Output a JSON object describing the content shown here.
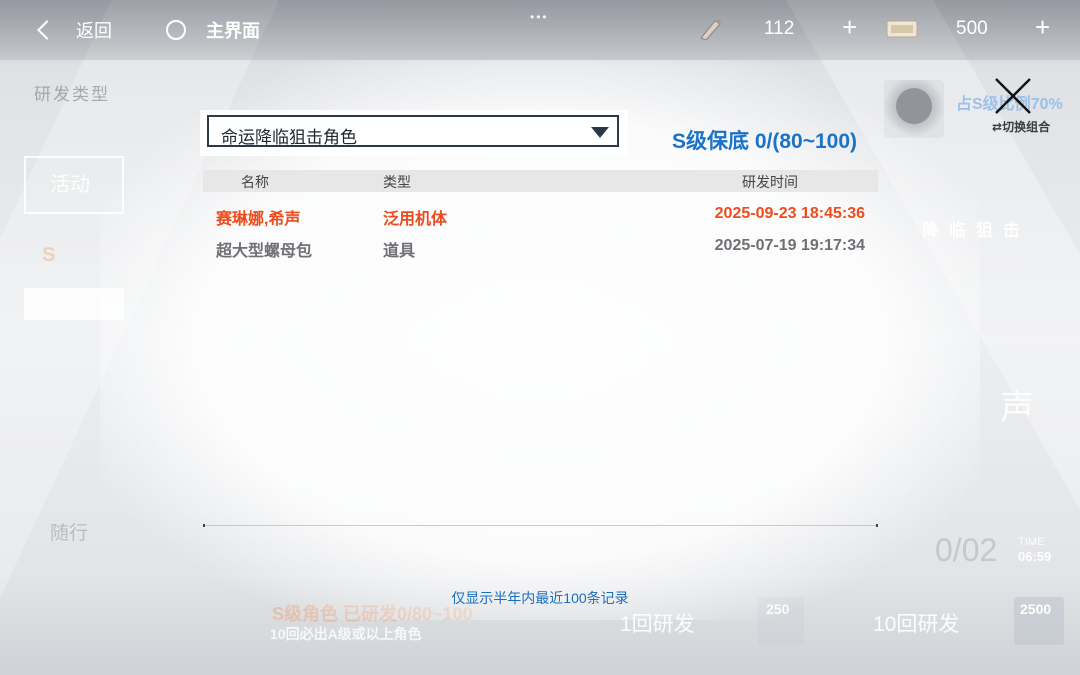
{
  "topbar": {
    "back_label": "返回",
    "home_label": "主界面",
    "resource_1": {
      "icon": "pen-icon",
      "value": "112"
    },
    "resource_2": {
      "icon": "ticket-icon",
      "value": "500"
    },
    "plus": "+"
  },
  "dialog": {
    "dropdown_selected": "命运降临狙击角色",
    "pity_text": "S级保底 0/(80~100)",
    "table": {
      "columns": [
        "名称",
        "类型",
        "研发时间"
      ],
      "rows": [
        {
          "name": "赛琳娜,希声",
          "type": "泛用机体",
          "time": "2025-09-23 18:45:36",
          "highlight": true
        },
        {
          "name": "超大型螺母包",
          "type": "道具",
          "time": "2025-07-19 19:17:34",
          "highlight": false
        }
      ]
    },
    "footnote": "仅显示半年内最近100条记录"
  },
  "background": {
    "type_label": "研发类型",
    "activity_label": "活动",
    "suixing_label": "随行",
    "rate_text": "占S级比例70%",
    "switch_label": "切换组合",
    "side_banner": "降临狙击",
    "big_char": "声",
    "date_text": "0/02",
    "time_label": "TIME",
    "time_value": "06:59",
    "bottom_line1": "S级角色 已研发0/80~100",
    "bottom_line2": "10回必出A级或以上角色",
    "one_pull": "1回研发",
    "ten_pull": "10回研发",
    "cost_one": "250",
    "cost_ten": "2500"
  },
  "colors": {
    "accent_blue": "#1a73c6",
    "highlight_orange": "#ee4b1e",
    "normal_gray": "#6f7075"
  }
}
